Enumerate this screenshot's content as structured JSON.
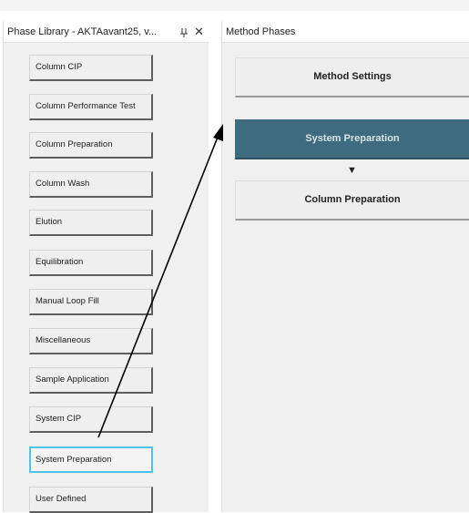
{
  "phase_library": {
    "title": "Phase Library - AKTAavant25, v...",
    "pin_glyph": "ѥ",
    "close_glyph": "✕",
    "items": [
      {
        "label": "Column CIP"
      },
      {
        "label": "Column Performance Test"
      },
      {
        "label": "Column Preparation"
      },
      {
        "label": "Column Wash"
      },
      {
        "label": "Elution"
      },
      {
        "label": "Equilibration"
      },
      {
        "label": "Manual Loop Fill"
      },
      {
        "label": "Miscellaneous"
      },
      {
        "label": "Sample Application"
      },
      {
        "label": "System CIP"
      },
      {
        "label": "System Preparation",
        "selected": true
      },
      {
        "label": "User Defined"
      }
    ]
  },
  "method_phases": {
    "title": "Method Phases",
    "settings_label": "Method Settings",
    "phases": [
      {
        "label": "System Preparation",
        "active": true
      },
      {
        "label": "Column Preparation",
        "active": false
      }
    ],
    "flow_arrow": "▼"
  },
  "colors": {
    "active_phase_bg": "#3f6b7e",
    "selected_outline": "#4fc3e8",
    "annotation_arrow": "#000000"
  }
}
